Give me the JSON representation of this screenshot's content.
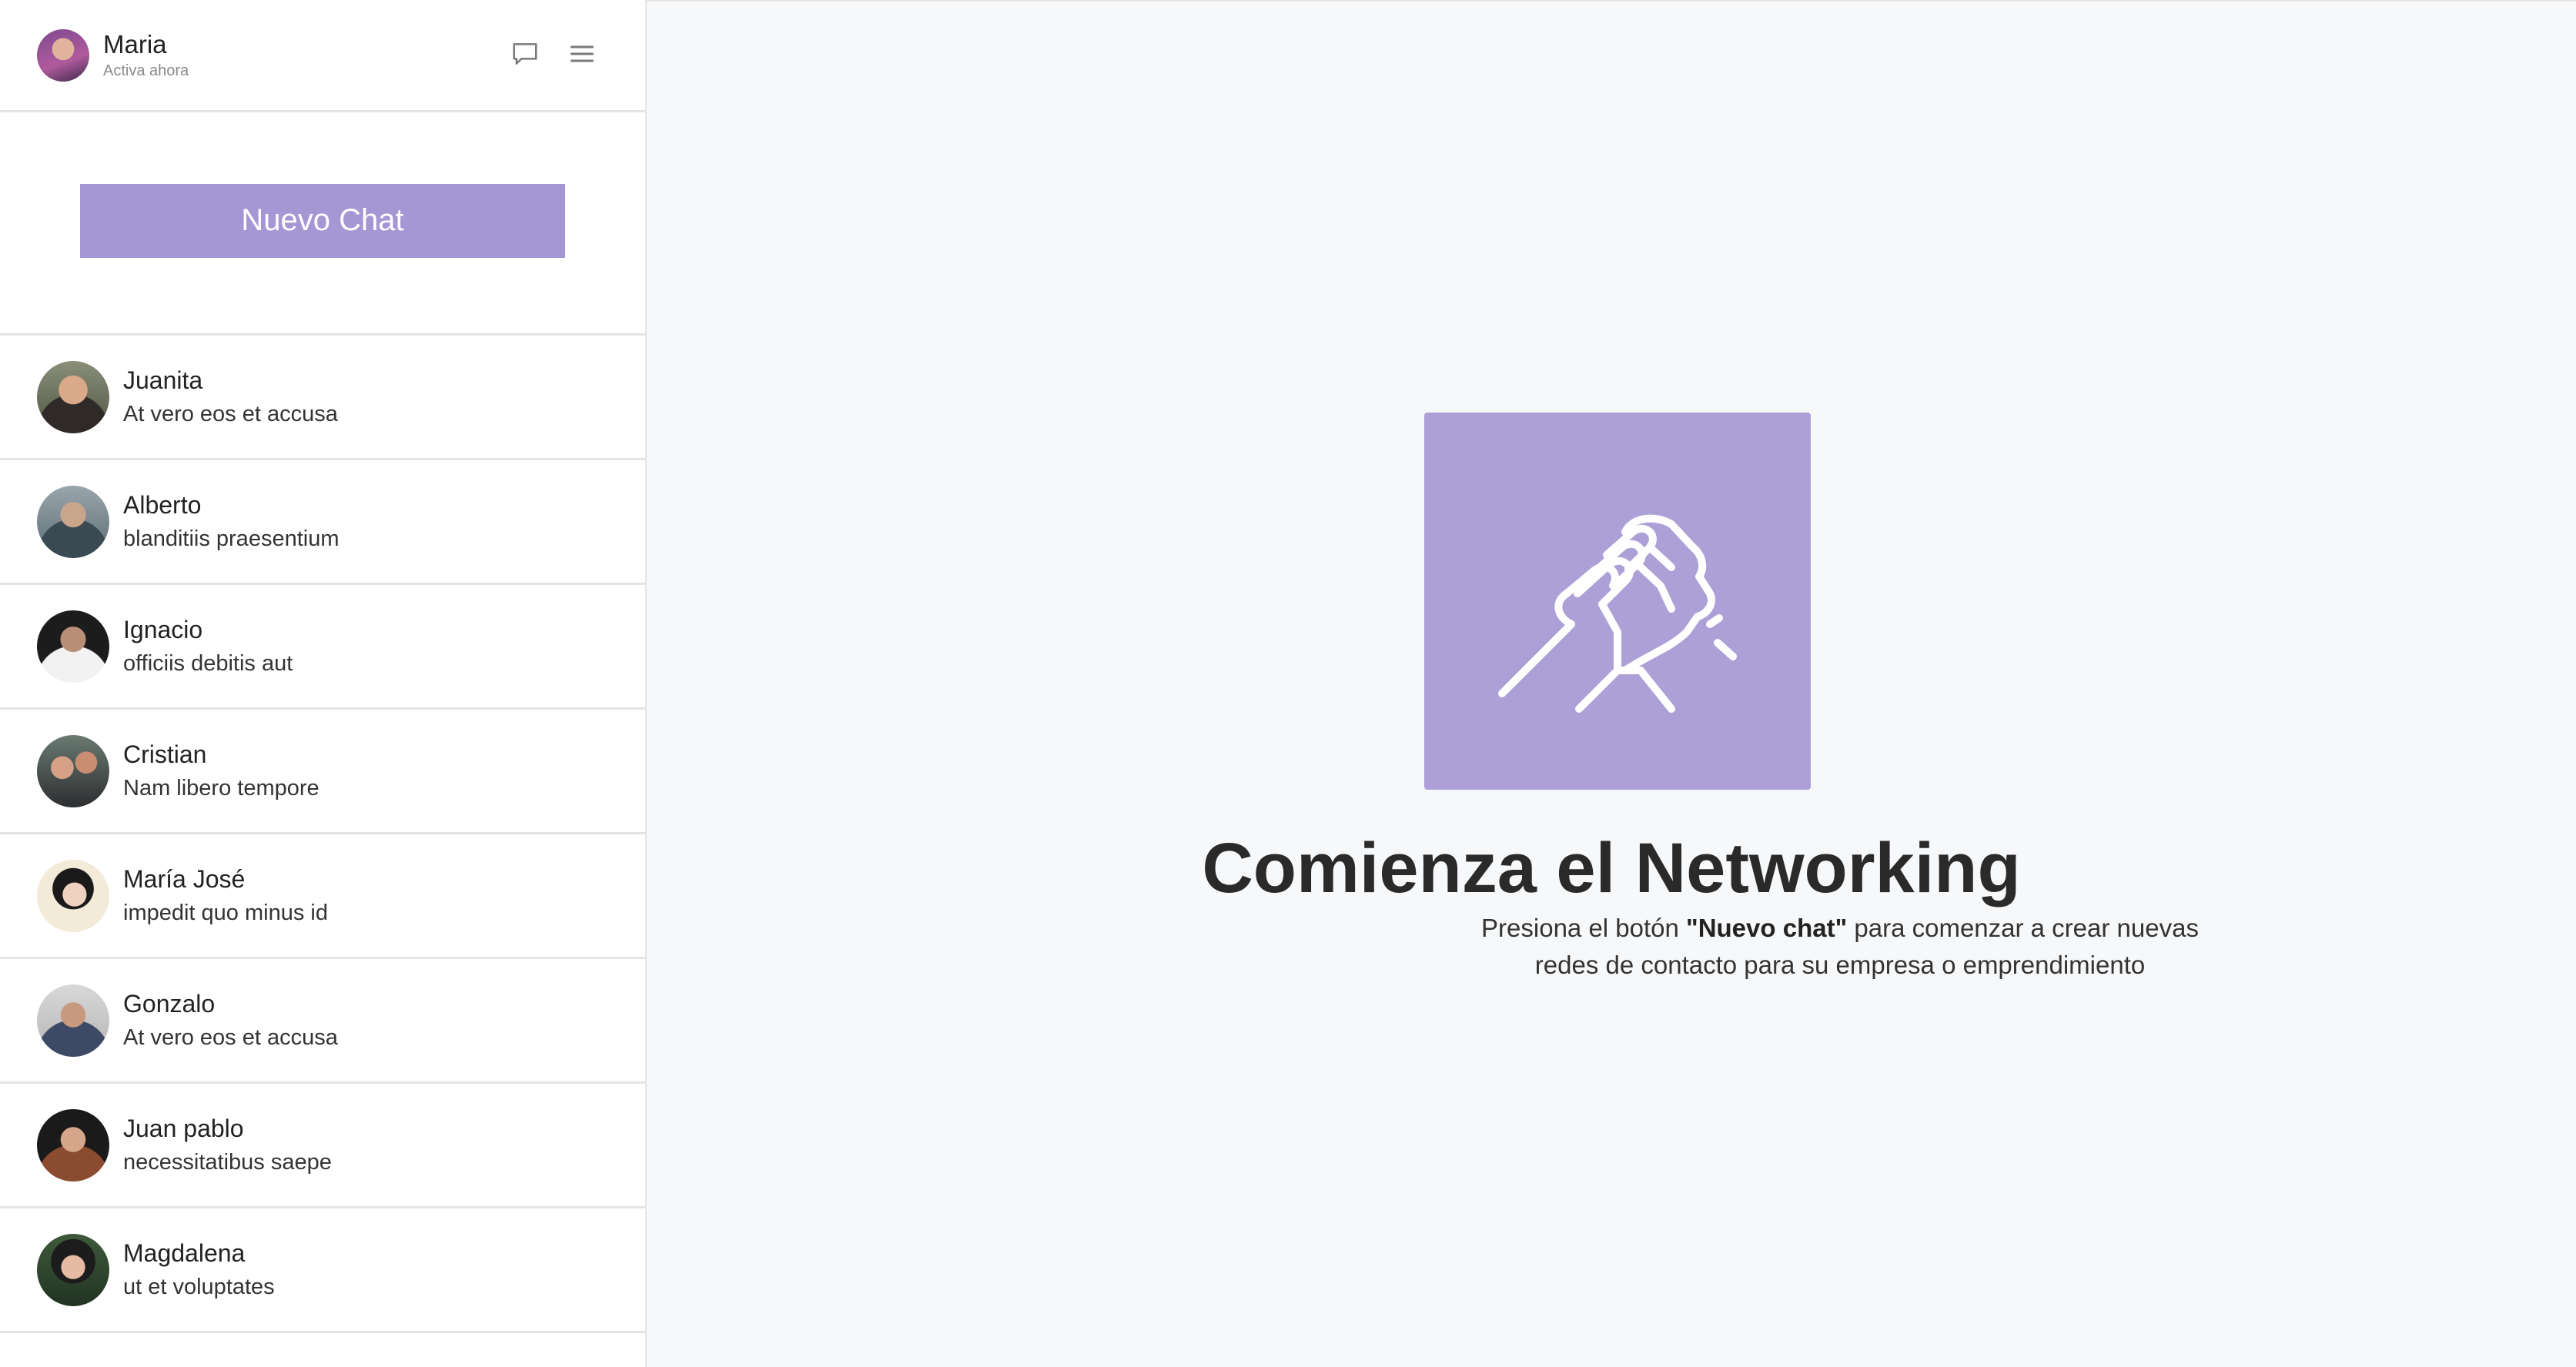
{
  "user": {
    "name": "Maria",
    "status": "Activa ahora",
    "icons": [
      "chat-bubble-icon",
      "menu-icon"
    ]
  },
  "new_chat": {
    "label": "Nuevo Chat"
  },
  "chats": [
    {
      "name": "Juanita",
      "message": "At vero eos et accusa"
    },
    {
      "name": "Alberto",
      "message": "blanditiis praesentium"
    },
    {
      "name": "Ignacio",
      "message": "officiis debitis aut"
    },
    {
      "name": "Cristian",
      "message": "Nam libero tempore"
    },
    {
      "name": "María José",
      "message": "impedit quo minus id"
    },
    {
      "name": "Gonzalo",
      "message": "At vero eos et accusa"
    },
    {
      "name": "Juan pablo",
      "message": "necessitatibus saepe"
    },
    {
      "name": "Magdalena",
      "message": "ut et voluptates"
    }
  ],
  "hero": {
    "icon": "handshake-icon",
    "title": "Comienza el Networking",
    "subtitle_pre": "Presiona el botón ",
    "subtitle_bold": "\"Nuevo chat\"",
    "subtitle_post": " para comenzar a crear nuevas redes de contacto para su empresa o emprendimiento"
  },
  "colors": {
    "accent": "#a497d3",
    "hero_box": "#ada0d6",
    "background": "#f7f8fa"
  }
}
